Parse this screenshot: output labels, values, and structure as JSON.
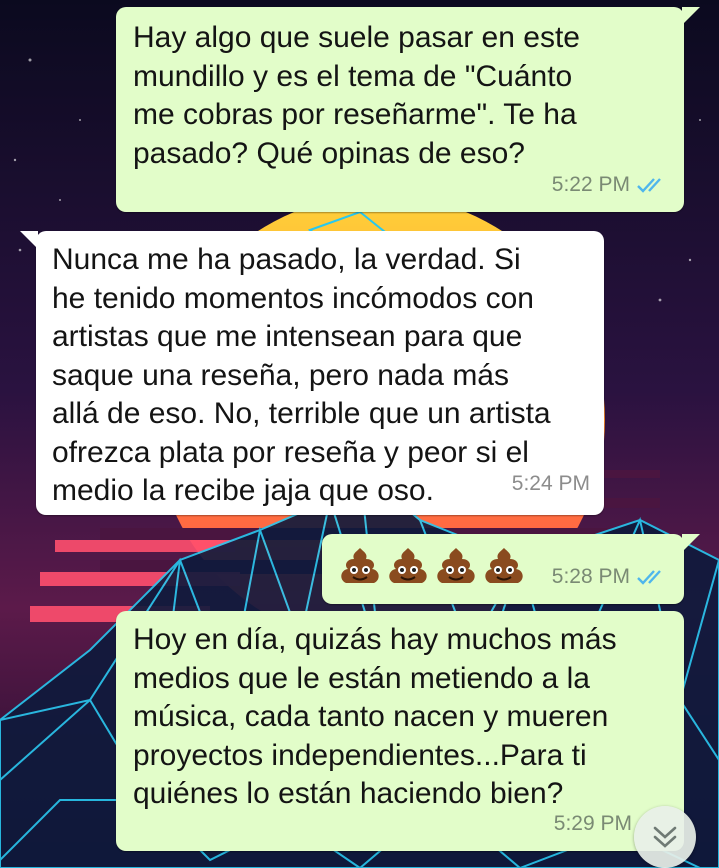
{
  "messages": [
    {
      "direction": "outgoing",
      "text": "Hay algo que suele pasar en este\nmundillo y es el tema de \"Cuánto\nme cobras por reseñarme\". Te ha\npasado? Qué opinas de eso?",
      "time": "5:22 PM",
      "status": "read"
    },
    {
      "direction": "incoming",
      "text": "Nunca me ha pasado, la verdad. Si\nhe tenido momentos incómodos con\nartistas que me intensean para que\nsaque una reseña, pero nada más\nallá de eso. No, terrible que un artista\nofrezca plata por reseña y peor si el\nmedio la recibe jaja que oso.",
      "time": "5:24 PM"
    },
    {
      "direction": "outgoing",
      "emoji": [
        "pile-of-poo",
        "pile-of-poo",
        "pile-of-poo",
        "pile-of-poo"
      ],
      "time": "5:28 PM",
      "status": "read"
    },
    {
      "direction": "outgoing",
      "text": "Hoy en día, quizás hay muchos más\nmedios que le están metiendo a la\nmúsica, cada tanto nacen y mueren\nproyectos independientes...Para ti\nquiénes lo están haciendo bien?",
      "time": "5:29 PM",
      "status": "pending"
    }
  ],
  "colors": {
    "outgoing_bubble": "#e2fdc9",
    "incoming_bubble": "#ffffff",
    "read_ticks": "#4fb6ec"
  },
  "icons": {
    "read_receipt": "double-check-icon",
    "scroll_down": "double-chevron-down-icon",
    "emoji": "pile-of-poo-emoji"
  }
}
